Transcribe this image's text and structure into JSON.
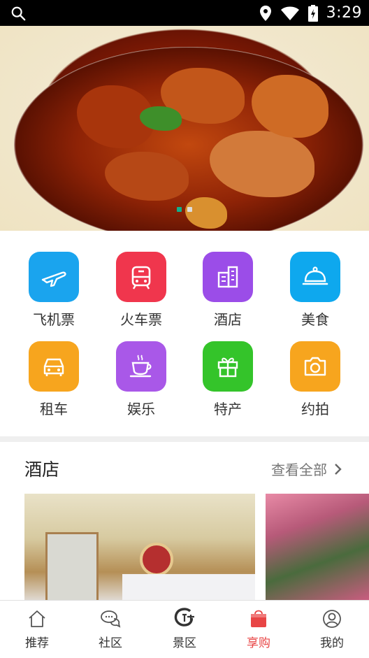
{
  "status_bar": {
    "time": "3:29"
  },
  "categories": [
    {
      "label": "飞机票",
      "icon": "plane-icon",
      "color": "#1aa4ee"
    },
    {
      "label": "火车票",
      "icon": "train-icon",
      "color": "#f0364d"
    },
    {
      "label": "酒店",
      "icon": "hotel-icon",
      "color": "#9b4de8"
    },
    {
      "label": "美食",
      "icon": "food-cloche-icon",
      "color": "#0ea8ee"
    },
    {
      "label": "租车",
      "icon": "car-icon",
      "color": "#f7a51e"
    },
    {
      "label": "娱乐",
      "icon": "coffee-cup-icon",
      "color": "#a958e8"
    },
    {
      "label": "特产",
      "icon": "gift-icon",
      "color": "#34c42a"
    },
    {
      "label": "约拍",
      "icon": "camera-icon",
      "color": "#f7a51e"
    }
  ],
  "hotel_section": {
    "title": "酒店",
    "see_all": "查看全部"
  },
  "bottom_nav": [
    {
      "label": "推荐",
      "icon": "home-icon",
      "active": false
    },
    {
      "label": "社区",
      "icon": "chat-icon",
      "active": false
    },
    {
      "label": "景区",
      "icon": "scenic-logo-icon",
      "active": false
    },
    {
      "label": "享购",
      "icon": "shopping-bag-icon",
      "active": true
    },
    {
      "label": "我的",
      "icon": "user-icon",
      "active": false
    }
  ],
  "colors": {
    "accent_active": "#e84545",
    "banner_indicator": "#10b08c"
  }
}
